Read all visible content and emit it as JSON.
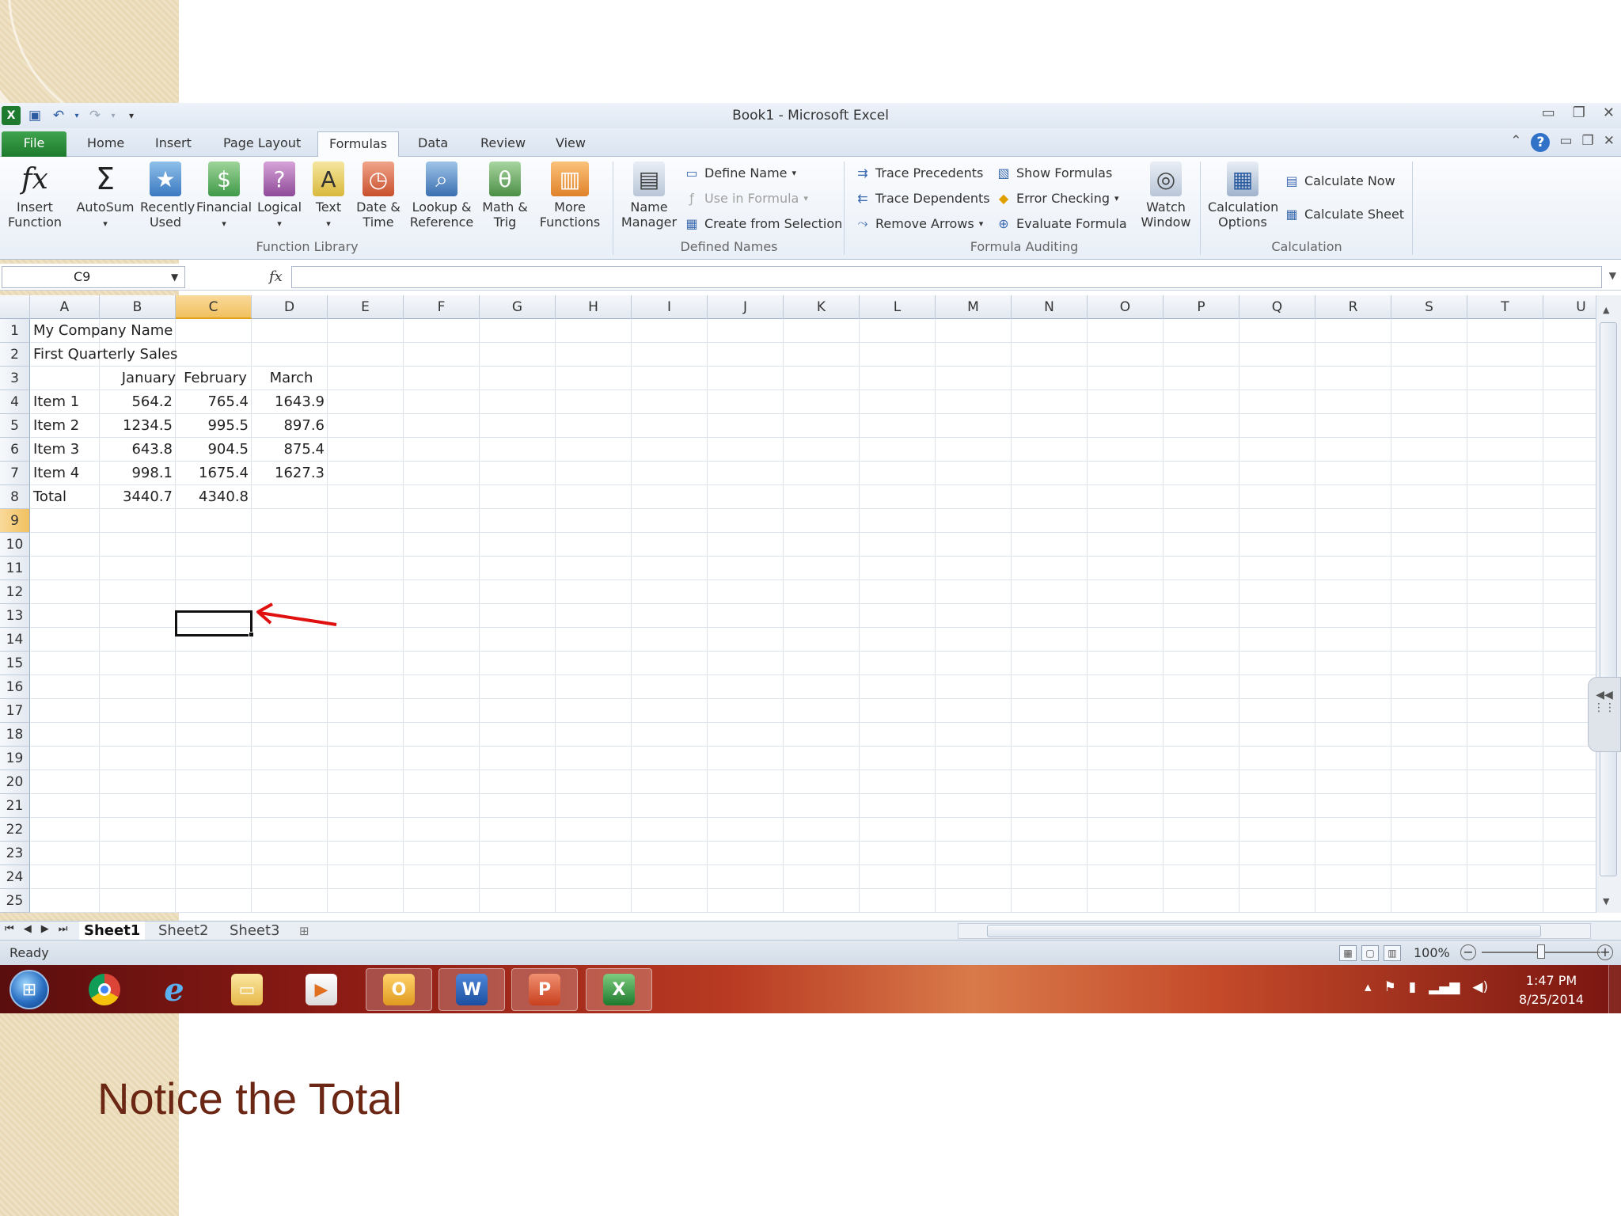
{
  "window": {
    "title": "Book1  -  Microsoft Excel"
  },
  "ribbon_tabs": [
    "File",
    "Home",
    "Insert",
    "Page Layout",
    "Formulas",
    "Data",
    "Review",
    "View"
  ],
  "function_library": {
    "group_label": "Function Library",
    "insert_function": "Insert Function",
    "autosum": "AutoSum",
    "recently_used": "Recently Used",
    "financial": "Financial",
    "logical": "Logical",
    "text": "Text",
    "date_time": "Date & Time",
    "lookup_reference": "Lookup & Reference",
    "math_trig": "Math & Trig",
    "more_functions": "More Functions"
  },
  "defined_names": {
    "group_label": "Defined Names",
    "name_manager": "Name Manager",
    "define_name": "Define Name",
    "use_in_formula": "Use in Formula",
    "create_from_selection": "Create from Selection"
  },
  "formula_auditing": {
    "group_label": "Formula Auditing",
    "trace_precedents": "Trace Precedents",
    "trace_dependents": "Trace Dependents",
    "remove_arrows": "Remove Arrows",
    "show_formulas": "Show Formulas",
    "error_checking": "Error Checking",
    "evaluate_formula": "Evaluate Formula",
    "watch_window": "Watch Window"
  },
  "calculation": {
    "group_label": "Calculation",
    "calculation_options": "Calculation Options",
    "calculate_now": "Calculate Now",
    "calculate_sheet": "Calculate Sheet"
  },
  "formula_bar": {
    "name_box": "C9",
    "formula": ""
  },
  "columns": [
    "A",
    "B",
    "C",
    "D",
    "E",
    "F",
    "G",
    "H",
    "I",
    "J",
    "K",
    "L",
    "M",
    "N",
    "O",
    "P",
    "Q",
    "R",
    "S",
    "T",
    "U"
  ],
  "selected_column": "C",
  "rows": [
    "1",
    "2",
    "3",
    "4",
    "5",
    "6",
    "7",
    "8",
    "9",
    "10",
    "11",
    "12",
    "13",
    "14",
    "15",
    "16",
    "17",
    "18",
    "19",
    "20",
    "21",
    "22",
    "23",
    "24",
    "25"
  ],
  "selected_row": "9",
  "cells": {
    "A1": "My Company Name",
    "A2": "First Quarterly Sales",
    "B3": "January",
    "C3": "February",
    "D3": "March",
    "A4": "Item 1",
    "B4": "564.2",
    "C4": "765.4",
    "D4": "1643.9",
    "A5": "Item 2",
    "B5": "1234.5",
    "C5": "995.5",
    "D5": "897.6",
    "A6": "Item 3",
    "B6": "643.8",
    "C6": "904.5",
    "D6": "875.4",
    "A7": "Item 4",
    "B7": "998.1",
    "C7": "1675.4",
    "D7": "1627.3",
    "A8": "Total",
    "B8": "3440.7",
    "C8": "4340.8"
  },
  "sheets": [
    "Sheet1",
    "Sheet2",
    "Sheet3"
  ],
  "active_sheet": "Sheet1",
  "status": {
    "text": "Ready",
    "zoom": "100%",
    "zoom_fraction": 0.5
  },
  "taskbar": {
    "time": "1:47 PM",
    "date": "8/25/2014"
  },
  "annotation": {
    "arrow_color": "#e01010"
  },
  "slide": {
    "caption": "Notice the Total",
    "caption_color": "#6b2714"
  },
  "colors": {
    "file_tab": "#2e8b3a",
    "selection_header": "#f1c15f"
  }
}
